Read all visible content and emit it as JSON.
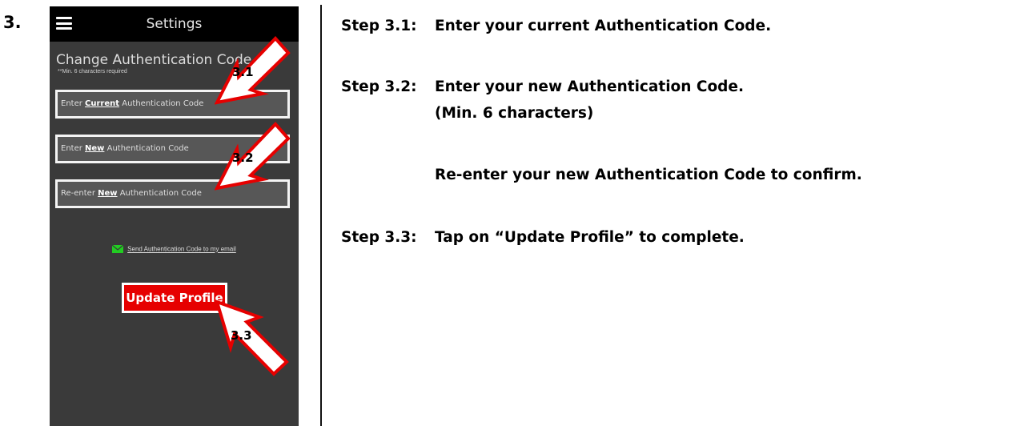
{
  "step_number": "3.",
  "phone": {
    "header_title": "Settings",
    "section_heading": "Change Authentication Code",
    "section_hint": "**Min. 6 characters required",
    "fields": {
      "current": {
        "prefix": "Enter ",
        "emphasis": "Current",
        "suffix": " Authentication Code"
      },
      "new": {
        "prefix": "Enter ",
        "emphasis": "New",
        "suffix": " Authentication Code"
      },
      "reenter": {
        "prefix": "Re-enter ",
        "emphasis": "New",
        "suffix": " Authentication Code"
      }
    },
    "email_link_label": "Send Authentication Code to my email",
    "update_button_label": "Update Profile"
  },
  "callouts": [
    "3.1",
    "3.2",
    "3.3"
  ],
  "instructions": {
    "step_3_1": {
      "tag": "Step 3.1:",
      "text": "Enter your current Authentication Code."
    },
    "step_3_2": {
      "tag": "Step 3.2:",
      "text": "Enter your new Authentication Code."
    },
    "step_3_2_note": "(Min. 6 characters)",
    "step_3_2_confirm": "Re-enter your new Authentication Code to confirm.",
    "step_3_3": {
      "tag": "Step 3.3:",
      "text": "Tap on “Update Profile” to complete."
    }
  },
  "colors": {
    "phone_background": "#3a3a3a",
    "header_background": "#000000",
    "button_red": "#e60000",
    "mail_icon_green": "#22cc22",
    "callout_red": "#e60000"
  }
}
